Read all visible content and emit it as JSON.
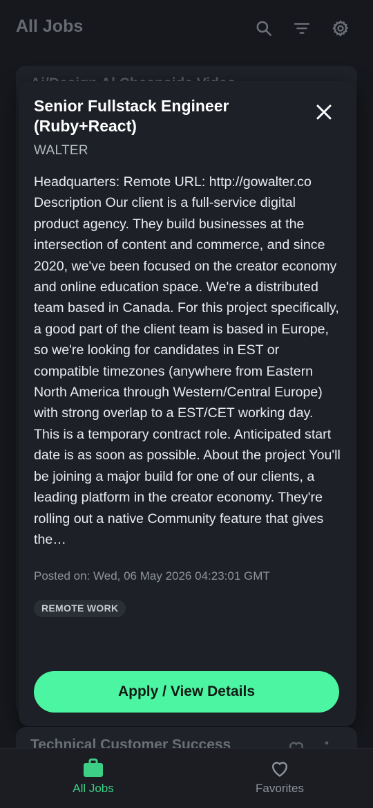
{
  "header": {
    "title": "All Jobs",
    "icons": [
      "search-icon",
      "filter-icon",
      "gear-icon"
    ]
  },
  "background_list": {
    "first_card_title": "Ai/Design Al Cheapside Video",
    "last_card_title": "Technical Customer Success"
  },
  "dialog": {
    "title": "Senior Fullstack Engineer (Ruby+React)",
    "company": "WALTER",
    "description": "Headquarters: Remote URL: http://gowalter.co Description Our client is a full-service digital product agency. They build businesses at the intersection of content and commerce, and since 2020, we've been focused on the creator economy and online education space. We're a distributed team based in Canada. For this project specifically, a good part of the client team is based in Europe, so we're looking for candidates in EST or compatible timezones (anywhere from Eastern North America through Western/Central Europe) with strong overlap to a EST/CET working day. This is a temporary contract role. Anticipated start date is as soon as possible. About the project You'll be joining a major build for one of our clients, a leading platform in the creator economy. They're rolling out a native Community feature that gives the…",
    "posted": "Posted on: Wed, 06 May 2026 04:23:01 GMT",
    "tag": "REMOTE WORK",
    "apply_label": "Apply / View Details"
  },
  "bottom_nav": {
    "items": [
      {
        "label": "All Jobs",
        "icon": "briefcase-icon",
        "active": true
      },
      {
        "label": "Favorites",
        "icon": "heart-icon",
        "active": false
      }
    ]
  },
  "colors": {
    "accent": "#4cf5a1",
    "active_nav": "#3ecf86",
    "dialog_bg": "#1d2027",
    "page_bg": "#16181d"
  }
}
